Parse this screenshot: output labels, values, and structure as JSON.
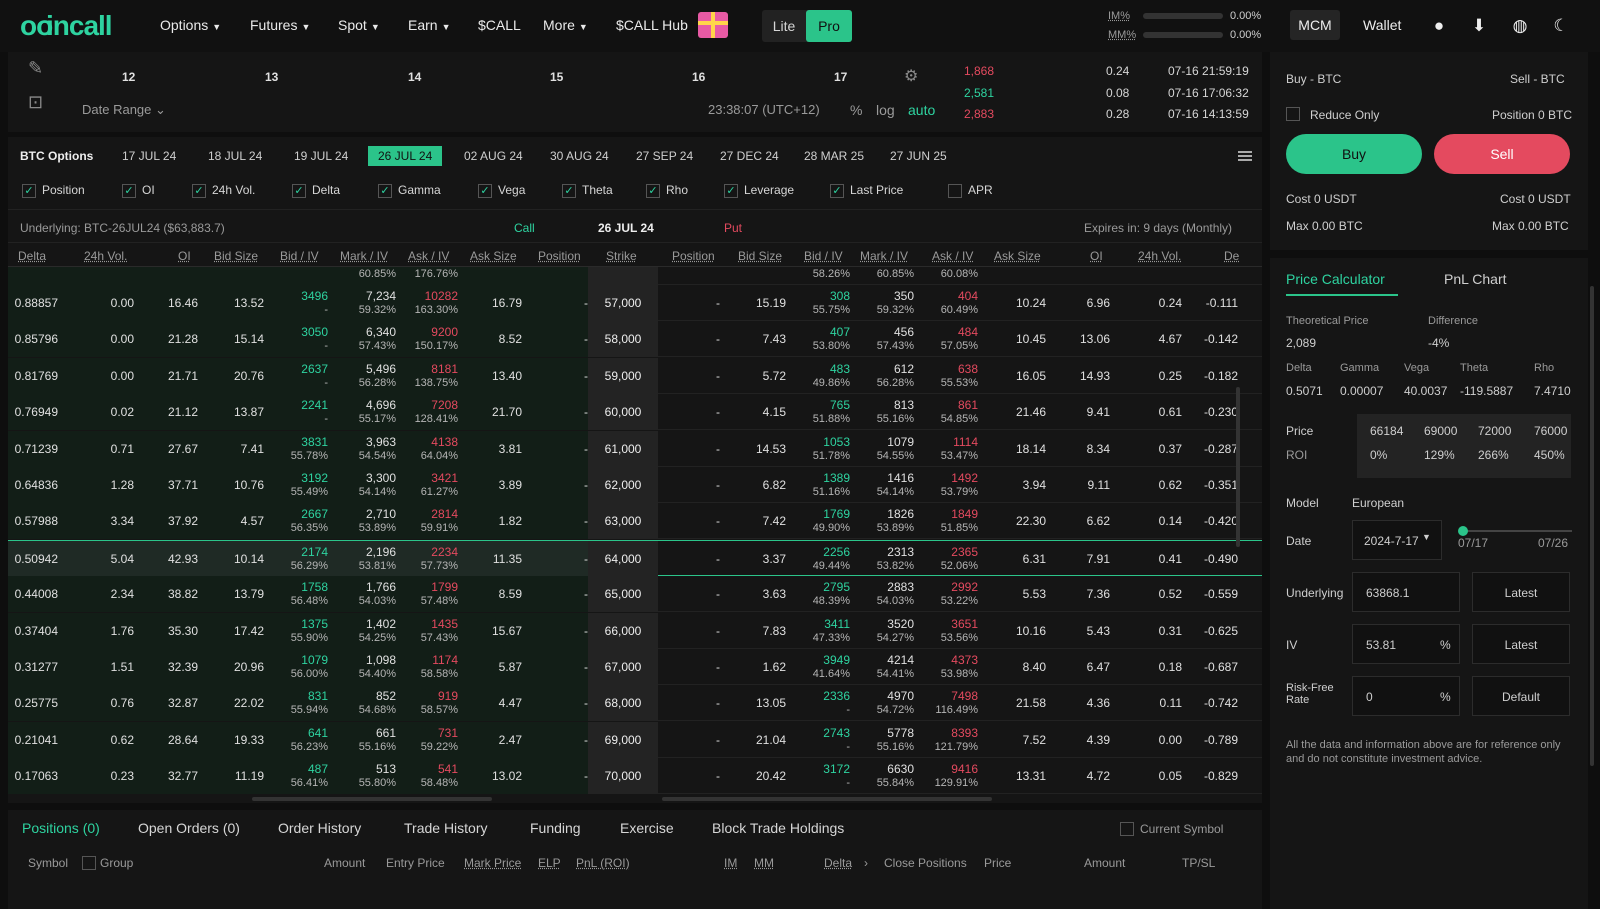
{
  "topnav": {
    "logo": "incall",
    "items": [
      "Options",
      "Futures",
      "Spot",
      "Earn",
      "$CALL",
      "More",
      "$CALL Hub"
    ],
    "lite": "Lite",
    "pro": "Pro",
    "im_label": "IM%",
    "mm_label": "MM%",
    "im_pct": "0.00%",
    "mm_pct": "0.00%",
    "mcm": "MCM",
    "wallet": "Wallet"
  },
  "chart": {
    "x_ticks": [
      "12",
      "13",
      "14",
      "15",
      "16",
      "17"
    ],
    "date_range": "Date Range",
    "clock": "23:38:07 (UTC+12)",
    "pct": "%",
    "log": "log",
    "auto": "auto"
  },
  "trades": [
    {
      "price": "1,868",
      "amount": "0.24",
      "time": "07-16 21:59:19",
      "color": "#e44a5f"
    },
    {
      "price": "2,581",
      "amount": "0.08",
      "time": "07-16 17:06:32",
      "color": "#2ed3a0"
    },
    {
      "price": "2,883",
      "amount": "0.28",
      "time": "07-16 14:13:59",
      "color": "#e44a5f"
    }
  ],
  "chain": {
    "asset": "BTC Options",
    "expiries": [
      "17 JUL 24",
      "18 JUL 24",
      "19 JUL 24",
      "26 JUL 24",
      "02 AUG 24",
      "30 AUG 24",
      "27 SEP 24",
      "27 DEC 24",
      "28 MAR 25",
      "27 JUN 25"
    ],
    "active_expiry": "26 JUL 24",
    "checks": [
      {
        "label": "Position",
        "on": true
      },
      {
        "label": "OI",
        "on": true
      },
      {
        "label": "24h Vol.",
        "on": true
      },
      {
        "label": "Delta",
        "on": true
      },
      {
        "label": "Gamma",
        "on": true
      },
      {
        "label": "Vega",
        "on": true
      },
      {
        "label": "Theta",
        "on": true
      },
      {
        "label": "Rho",
        "on": true
      },
      {
        "label": "Leverage",
        "on": true
      },
      {
        "label": "Last Price",
        "on": true
      },
      {
        "label": "APR",
        "on": false
      }
    ],
    "underlying": "Underlying: BTC-26JUL24 ($63,883.7)",
    "call_label": "Call",
    "date_label": "26 JUL 24",
    "put_label": "Put",
    "expires": "Expires in: 9 days (Monthly)",
    "headers_call": [
      "Delta",
      "24h Vol.",
      "OI",
      "Bid Size",
      "Bid / IV",
      "Mark / IV",
      "Ask / IV",
      "Ask Size",
      "Position"
    ],
    "strike_header": "Strike",
    "headers_put": [
      "Position",
      "Bid Size",
      "Bid / IV",
      "Mark / IV",
      "Ask / IV",
      "Ask Size",
      "OI",
      "24h Vol.",
      "De"
    ],
    "top_partial": {
      "c_mark_iv": "60.85%",
      "c_ask_iv": "176.76%",
      "p_bid_iv": "58.26%",
      "p_mark_iv": "60.85%",
      "p_ask_iv": "60.08%"
    },
    "rows": [
      {
        "delta": "0.88857",
        "vol": "0.00",
        "oi": "16.46",
        "bsize": "13.52",
        "bid": "3496",
        "bidiv": "-",
        "mark": "7,234",
        "markiv": "59.32%",
        "ask": "10282",
        "askiv": "163.30%",
        "asize": "16.79",
        "pos": "-",
        "strike": "57,000",
        "ppos": "-",
        "pbsize": "15.19",
        "pbid": "308",
        "pbidiv": "55.75%",
        "pmark": "350",
        "pmarkiv": "59.32%",
        "pask": "404",
        "paskiv": "60.49%",
        "pasize": "10.24",
        "poi": "6.96",
        "pvol": "0.24",
        "pdelta": "-0.111"
      },
      {
        "delta": "0.85796",
        "vol": "0.00",
        "oi": "21.28",
        "bsize": "15.14",
        "bid": "3050",
        "bidiv": "-",
        "mark": "6,340",
        "markiv": "57.43%",
        "ask": "9200",
        "askiv": "150.17%",
        "asize": "8.52",
        "pos": "-",
        "strike": "58,000",
        "ppos": "-",
        "pbsize": "7.43",
        "pbid": "407",
        "pbidiv": "53.80%",
        "pmark": "456",
        "pmarkiv": "57.43%",
        "pask": "484",
        "paskiv": "57.05%",
        "pasize": "10.45",
        "poi": "13.06",
        "pvol": "4.67",
        "pdelta": "-0.142"
      },
      {
        "delta": "0.81769",
        "vol": "0.00",
        "oi": "21.71",
        "bsize": "20.76",
        "bid": "2637",
        "bidiv": "-",
        "mark": "5,496",
        "markiv": "56.28%",
        "ask": "8181",
        "askiv": "138.75%",
        "asize": "13.40",
        "pos": "-",
        "strike": "59,000",
        "ppos": "-",
        "pbsize": "5.72",
        "pbid": "483",
        "pbidiv": "49.86%",
        "pmark": "612",
        "pmarkiv": "56.28%",
        "pask": "638",
        "paskiv": "55.53%",
        "pasize": "16.05",
        "poi": "14.93",
        "pvol": "0.25",
        "pdelta": "-0.182"
      },
      {
        "delta": "0.76949",
        "vol": "0.02",
        "oi": "21.12",
        "bsize": "13.87",
        "bid": "2241",
        "bidiv": "-",
        "mark": "4,696",
        "markiv": "55.17%",
        "ask": "7208",
        "askiv": "128.41%",
        "asize": "21.70",
        "pos": "-",
        "strike": "60,000",
        "ppos": "-",
        "pbsize": "4.15",
        "pbid": "765",
        "pbidiv": "51.88%",
        "pmark": "813",
        "pmarkiv": "55.16%",
        "pask": "861",
        "paskiv": "54.85%",
        "pasize": "21.46",
        "poi": "9.41",
        "pvol": "0.61",
        "pdelta": "-0.230"
      },
      {
        "delta": "0.71239",
        "vol": "0.71",
        "oi": "27.67",
        "bsize": "7.41",
        "bid": "3831",
        "bidiv": "55.78%",
        "mark": "3,963",
        "markiv": "54.54%",
        "ask": "4138",
        "askiv": "64.04%",
        "asize": "3.81",
        "pos": "-",
        "strike": "61,000",
        "ppos": "-",
        "pbsize": "14.53",
        "pbid": "1053",
        "pbidiv": "51.78%",
        "pmark": "1079",
        "pmarkiv": "54.55%",
        "pask": "1114",
        "paskiv": "53.47%",
        "pasize": "18.14",
        "poi": "8.34",
        "pvol": "0.37",
        "pdelta": "-0.287"
      },
      {
        "delta": "0.64836",
        "vol": "1.28",
        "oi": "37.71",
        "bsize": "10.76",
        "bid": "3192",
        "bidiv": "55.49%",
        "mark": "3,300",
        "markiv": "54.14%",
        "ask": "3421",
        "askiv": "61.27%",
        "asize": "3.89",
        "pos": "-",
        "strike": "62,000",
        "ppos": "-",
        "pbsize": "6.82",
        "pbid": "1389",
        "pbidiv": "51.16%",
        "pmark": "1416",
        "pmarkiv": "54.14%",
        "pask": "1492",
        "paskiv": "53.79%",
        "pasize": "3.94",
        "poi": "9.11",
        "pvol": "0.62",
        "pdelta": "-0.351"
      },
      {
        "delta": "0.57988",
        "vol": "3.34",
        "oi": "37.92",
        "bsize": "4.57",
        "bid": "2667",
        "bidiv": "56.35%",
        "mark": "2,710",
        "markiv": "53.89%",
        "ask": "2814",
        "askiv": "59.91%",
        "asize": "1.82",
        "pos": "-",
        "strike": "63,000",
        "ppos": "-",
        "pbsize": "7.42",
        "pbid": "1769",
        "pbidiv": "49.90%",
        "pmark": "1826",
        "pmarkiv": "53.89%",
        "pask": "1849",
        "paskiv": "51.85%",
        "pasize": "22.30",
        "poi": "6.62",
        "pvol": "0.14",
        "pdelta": "-0.420"
      },
      {
        "delta": "0.50942",
        "vol": "5.04",
        "oi": "42.93",
        "bsize": "10.14",
        "bid": "2174",
        "bidiv": "56.29%",
        "mark": "2,196",
        "markiv": "53.81%",
        "ask": "2234",
        "askiv": "57.73%",
        "asize": "11.35",
        "pos": "-",
        "strike": "64,000",
        "ppos": "-",
        "pbsize": "3.37",
        "pbid": "2256",
        "pbidiv": "49.44%",
        "pmark": "2313",
        "pmarkiv": "53.82%",
        "pask": "2365",
        "paskiv": "52.06%",
        "pasize": "6.31",
        "poi": "7.91",
        "pvol": "0.41",
        "pdelta": "-0.490",
        "atm": true
      },
      {
        "delta": "0.44008",
        "vol": "2.34",
        "oi": "38.82",
        "bsize": "13.79",
        "bid": "1758",
        "bidiv": "56.48%",
        "mark": "1,766",
        "markiv": "54.03%",
        "ask": "1799",
        "askiv": "57.48%",
        "asize": "8.59",
        "pos": "-",
        "strike": "65,000",
        "ppos": "-",
        "pbsize": "3.63",
        "pbid": "2795",
        "pbidiv": "48.39%",
        "pmark": "2883",
        "pmarkiv": "54.03%",
        "pask": "2992",
        "paskiv": "53.22%",
        "pasize": "5.53",
        "poi": "7.36",
        "pvol": "0.52",
        "pdelta": "-0.559"
      },
      {
        "delta": "0.37404",
        "vol": "1.76",
        "oi": "35.30",
        "bsize": "17.42",
        "bid": "1375",
        "bidiv": "55.90%",
        "mark": "1,402",
        "markiv": "54.25%",
        "ask": "1435",
        "askiv": "57.43%",
        "asize": "15.67",
        "pos": "-",
        "strike": "66,000",
        "ppos": "-",
        "pbsize": "7.83",
        "pbid": "3411",
        "pbidiv": "47.33%",
        "pmark": "3520",
        "pmarkiv": "54.27%",
        "pask": "3651",
        "paskiv": "53.56%",
        "pasize": "10.16",
        "poi": "5.43",
        "pvol": "0.31",
        "pdelta": "-0.625"
      },
      {
        "delta": "0.31277",
        "vol": "1.51",
        "oi": "32.39",
        "bsize": "20.96",
        "bid": "1079",
        "bidiv": "56.00%",
        "mark": "1,098",
        "markiv": "54.40%",
        "ask": "1174",
        "askiv": "58.58%",
        "asize": "5.87",
        "pos": "-",
        "strike": "67,000",
        "ppos": "-",
        "pbsize": "1.62",
        "pbid": "3949",
        "pbidiv": "41.64%",
        "pmark": "4214",
        "pmarkiv": "54.41%",
        "pask": "4373",
        "paskiv": "53.98%",
        "pasize": "8.40",
        "poi": "6.47",
        "pvol": "0.18",
        "pdelta": "-0.687"
      },
      {
        "delta": "0.25775",
        "vol": "0.76",
        "oi": "32.87",
        "bsize": "22.02",
        "bid": "831",
        "bidiv": "55.94%",
        "mark": "852",
        "markiv": "54.68%",
        "ask": "919",
        "askiv": "58.57%",
        "asize": "4.47",
        "pos": "-",
        "strike": "68,000",
        "ppos": "-",
        "pbsize": "13.05",
        "pbid": "2336",
        "pbidiv": "-",
        "pmark": "4970",
        "pmarkiv": "54.72%",
        "pask": "7498",
        "paskiv": "116.49%",
        "pasize": "21.58",
        "poi": "4.36",
        "pvol": "0.11",
        "pdelta": "-0.742"
      },
      {
        "delta": "0.21041",
        "vol": "0.62",
        "oi": "28.64",
        "bsize": "19.33",
        "bid": "641",
        "bidiv": "56.23%",
        "mark": "661",
        "markiv": "55.16%",
        "ask": "731",
        "askiv": "59.22%",
        "asize": "2.47",
        "pos": "-",
        "strike": "69,000",
        "ppos": "-",
        "pbsize": "21.04",
        "pbid": "2743",
        "pbidiv": "-",
        "pmark": "5778",
        "pmarkiv": "55.16%",
        "pask": "8393",
        "paskiv": "121.79%",
        "pasize": "7.52",
        "poi": "4.39",
        "pvol": "0.00",
        "pdelta": "-0.789"
      },
      {
        "delta": "0.17063",
        "vol": "0.23",
        "oi": "32.77",
        "bsize": "11.19",
        "bid": "487",
        "bidiv": "56.41%",
        "mark": "513",
        "markiv": "55.80%",
        "ask": "541",
        "askiv": "58.48%",
        "asize": "13.02",
        "pos": "-",
        "strike": "70,000",
        "ppos": "-",
        "pbsize": "20.42",
        "pbid": "3172",
        "pbidiv": "-",
        "pmark": "6630",
        "pmarkiv": "55.84%",
        "pask": "9416",
        "paskiv": "129.91%",
        "pasize": "13.31",
        "poi": "4.72",
        "pvol": "0.05",
        "pdelta": "-0.829"
      }
    ]
  },
  "bottom": {
    "tabs": [
      "Positions (0)",
      "Open Orders (0)",
      "Order History",
      "Trade History",
      "Funding",
      "Exercise",
      "Block Trade Holdings"
    ],
    "current_symbol": "Current Symbol",
    "headers": [
      "Symbol",
      "Group",
      "Amount",
      "Entry Price",
      "Mark Price",
      "ELP",
      "PnL (ROI)",
      "IM",
      "MM",
      "Delta",
      "Close Positions",
      "Price",
      "Amount",
      "TP/SL"
    ]
  },
  "order": {
    "buy_label": "Buy - BTC",
    "sell_label": "Sell - BTC",
    "reduce_only": "Reduce Only",
    "position": "Position 0 BTC",
    "buy": "Buy",
    "sell": "Sell",
    "cost_left": "Cost 0 USDT",
    "cost_right": "Cost 0 USDT",
    "max_left": "Max 0.00 BTC",
    "max_right": "Max 0.00 BTC"
  },
  "calc": {
    "tab1": "Price Calculator",
    "tab2": "PnL Chart",
    "theo_label": "Theoretical Price",
    "theo_value": "2,089",
    "diff_label": "Difference",
    "diff_value": "-4%",
    "greeks": [
      {
        "label": "Delta",
        "value": "0.5071"
      },
      {
        "label": "Gamma",
        "value": "0.00007"
      },
      {
        "label": "Vega",
        "value": "40.0037"
      },
      {
        "label": "Theta",
        "value": "-119.5887"
      },
      {
        "label": "Rho",
        "value": "7.4710"
      }
    ],
    "price_label": "Price",
    "roi_label": "ROI",
    "prices": [
      "66184",
      "69000",
      "72000",
      "76000"
    ],
    "rois": [
      "0%",
      "129%",
      "266%",
      "450%"
    ],
    "model_label": "Model",
    "model_value": "European",
    "date_label": "Date",
    "date_value": "2024-7-17",
    "date_start": "07/17",
    "date_end": "07/26",
    "underlying_label": "Underlying",
    "underlying_value": "63868.1",
    "latest": "Latest",
    "iv_label": "IV",
    "iv_value": "53.81",
    "pct": "%",
    "rfr_label": "Risk-Free Rate",
    "rfr_value": "0",
    "default": "Default",
    "disclaimer": "All the data and information above are for reference only and do not constitute investment advice."
  },
  "colors": {
    "accent": "#2bc48a",
    "red": "#e44a5f",
    "green": "#2ed3a0"
  }
}
